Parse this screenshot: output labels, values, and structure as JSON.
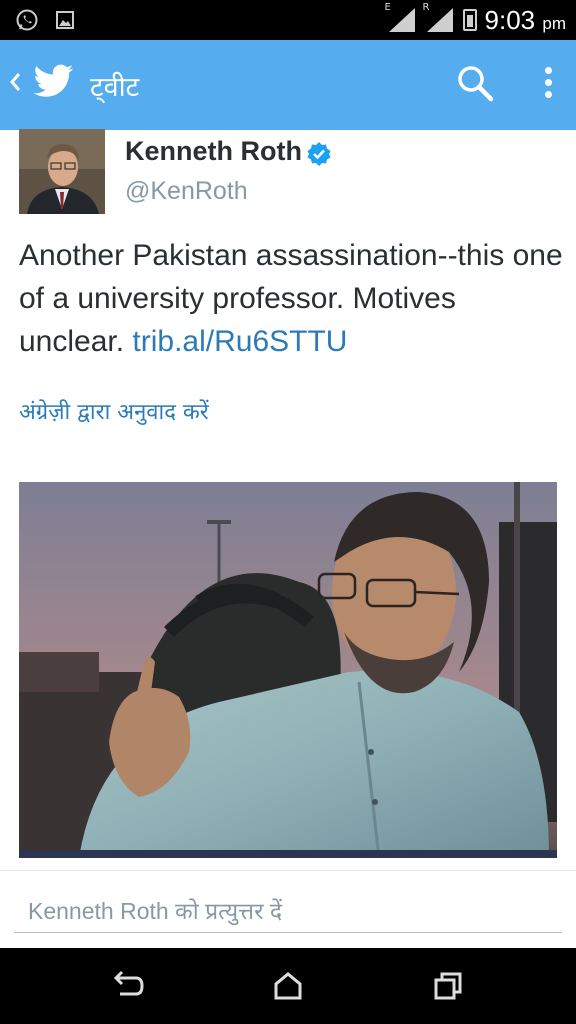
{
  "status_bar": {
    "time": "9:03",
    "ampm": "pm",
    "net1": "E",
    "net2": "R"
  },
  "app_bar": {
    "title": "ट्वीट",
    "icons": [
      "back-chevron-icon",
      "twitter-bird-icon",
      "search-icon",
      "overflow-menu-icon"
    ]
  },
  "tweet": {
    "author_name": "Kenneth Roth",
    "handle": "@KenRoth",
    "text": "Another Pakistan assassination--this one of a university professor. Motives unclear. ",
    "link": "trib.al/Ru6STTU",
    "translate_label": "अंग्रेज़ी द्वारा अनुवाद करें"
  },
  "reply": {
    "placeholder_name": "Kenneth Roth",
    "placeholder_suffix": " को प्रत्युत्तर दें"
  },
  "colors": {
    "accent": "#55ACEE",
    "link": "#2B7BB9",
    "verified": "#1DA1F2"
  }
}
